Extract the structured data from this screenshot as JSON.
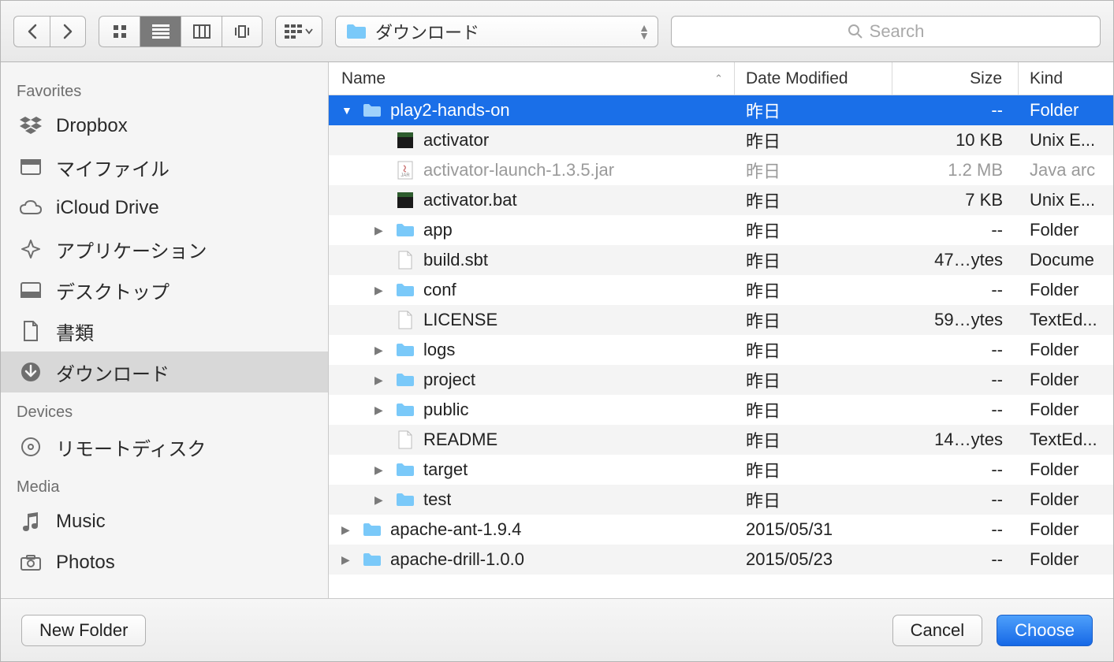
{
  "toolbar": {
    "path_label": "ダウンロード",
    "search_placeholder": "Search"
  },
  "sidebar": {
    "sections": [
      {
        "heading": "Favorites",
        "items": [
          {
            "icon": "dropbox",
            "label": "Dropbox"
          },
          {
            "icon": "myfiles",
            "label": "マイファイル"
          },
          {
            "icon": "icloud",
            "label": "iCloud Drive"
          },
          {
            "icon": "apps",
            "label": "アプリケーション"
          },
          {
            "icon": "desktop",
            "label": "デスクトップ"
          },
          {
            "icon": "documents",
            "label": "書類"
          },
          {
            "icon": "downloads",
            "label": "ダウンロード",
            "selected": true
          }
        ]
      },
      {
        "heading": "Devices",
        "items": [
          {
            "icon": "disc",
            "label": "リモートディスク"
          }
        ]
      },
      {
        "heading": "Media",
        "items": [
          {
            "icon": "music",
            "label": "Music"
          },
          {
            "icon": "photos",
            "label": "Photos"
          }
        ]
      }
    ]
  },
  "columns": {
    "name": "Name",
    "date": "Date Modified",
    "size": "Size",
    "kind": "Kind"
  },
  "files": [
    {
      "indent": 0,
      "disclosure": "down",
      "icon": "folder",
      "name": "play2-hands-on",
      "date": "昨日",
      "size": "--",
      "kind": "Folder",
      "selected": true
    },
    {
      "indent": 1,
      "disclosure": "",
      "icon": "exec",
      "name": "activator",
      "date": "昨日",
      "size": "10 KB",
      "kind": "Unix E..."
    },
    {
      "indent": 1,
      "disclosure": "",
      "icon": "jar",
      "name": "activator-launch-1.3.5.jar",
      "date": "昨日",
      "size": "1.2 MB",
      "kind": "Java arc",
      "dimmed": true
    },
    {
      "indent": 1,
      "disclosure": "",
      "icon": "exec",
      "name": "activator.bat",
      "date": "昨日",
      "size": "7 KB",
      "kind": "Unix E..."
    },
    {
      "indent": 1,
      "disclosure": "right",
      "icon": "folder",
      "name": "app",
      "date": "昨日",
      "size": "--",
      "kind": "Folder"
    },
    {
      "indent": 1,
      "disclosure": "",
      "icon": "doc",
      "name": "build.sbt",
      "date": "昨日",
      "size": "47…ytes",
      "kind": "Docume"
    },
    {
      "indent": 1,
      "disclosure": "right",
      "icon": "folder",
      "name": "conf",
      "date": "昨日",
      "size": "--",
      "kind": "Folder"
    },
    {
      "indent": 1,
      "disclosure": "",
      "icon": "doc",
      "name": "LICENSE",
      "date": "昨日",
      "size": "59…ytes",
      "kind": "TextEd..."
    },
    {
      "indent": 1,
      "disclosure": "right",
      "icon": "folder",
      "name": "logs",
      "date": "昨日",
      "size": "--",
      "kind": "Folder"
    },
    {
      "indent": 1,
      "disclosure": "right",
      "icon": "folder",
      "name": "project",
      "date": "昨日",
      "size": "--",
      "kind": "Folder"
    },
    {
      "indent": 1,
      "disclosure": "right",
      "icon": "folder",
      "name": "public",
      "date": "昨日",
      "size": "--",
      "kind": "Folder"
    },
    {
      "indent": 1,
      "disclosure": "",
      "icon": "doc",
      "name": "README",
      "date": "昨日",
      "size": "14…ytes",
      "kind": "TextEd..."
    },
    {
      "indent": 1,
      "disclosure": "right",
      "icon": "folder",
      "name": "target",
      "date": "昨日",
      "size": "--",
      "kind": "Folder"
    },
    {
      "indent": 1,
      "disclosure": "right",
      "icon": "folder",
      "name": "test",
      "date": "昨日",
      "size": "--",
      "kind": "Folder"
    },
    {
      "indent": 0,
      "disclosure": "right",
      "icon": "folder",
      "name": "apache-ant-1.9.4",
      "date": "2015/05/31",
      "size": "--",
      "kind": "Folder"
    },
    {
      "indent": 0,
      "disclosure": "right",
      "icon": "folder",
      "name": "apache-drill-1.0.0",
      "date": "2015/05/23",
      "size": "--",
      "kind": "Folder"
    }
  ],
  "footer": {
    "new_folder": "New Folder",
    "cancel": "Cancel",
    "choose": "Choose"
  }
}
